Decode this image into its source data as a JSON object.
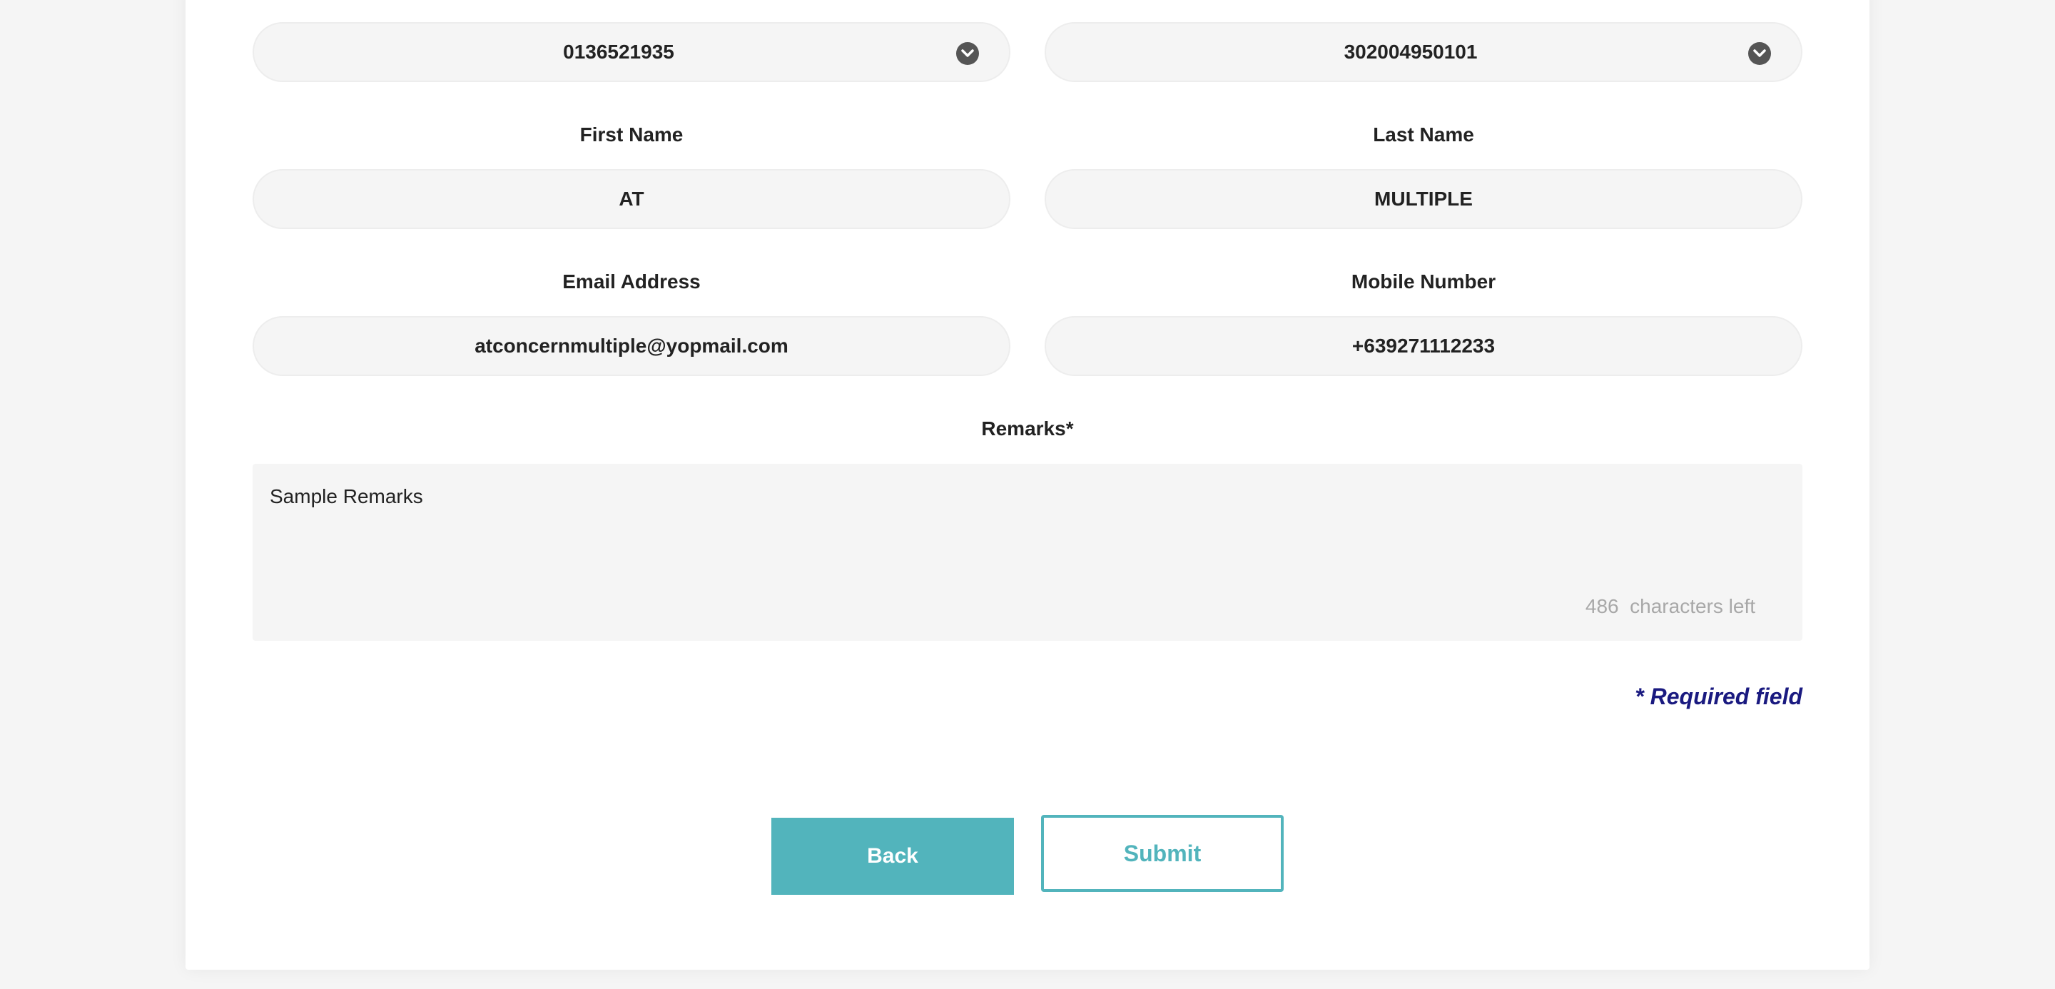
{
  "form": {
    "left_select": {
      "value": "0136521935",
      "icon": "chevron-down-circle-icon"
    },
    "right_select": {
      "value": "302004950101",
      "icon": "chevron-down-circle-icon"
    },
    "first_name": {
      "label": "First Name",
      "value": "AT"
    },
    "last_name": {
      "label": "Last Name",
      "value": "MULTIPLE"
    },
    "email": {
      "label": "Email Address",
      "value": "atconcernmultiple@yopmail.com"
    },
    "mobile": {
      "label": "Mobile Number",
      "value": "+639271112233"
    },
    "remarks": {
      "label": "Remarks*",
      "value": "Sample Remarks",
      "chars_left": "486  characters left"
    },
    "required_note": "* Required field"
  },
  "actions": {
    "back_label": "Back",
    "submit_label": "Submit"
  },
  "colors": {
    "accent": "#52b4bc",
    "required": "#1a1a80",
    "field_bg": "#f5f5f5",
    "page_bg": "#f5f5f5"
  }
}
